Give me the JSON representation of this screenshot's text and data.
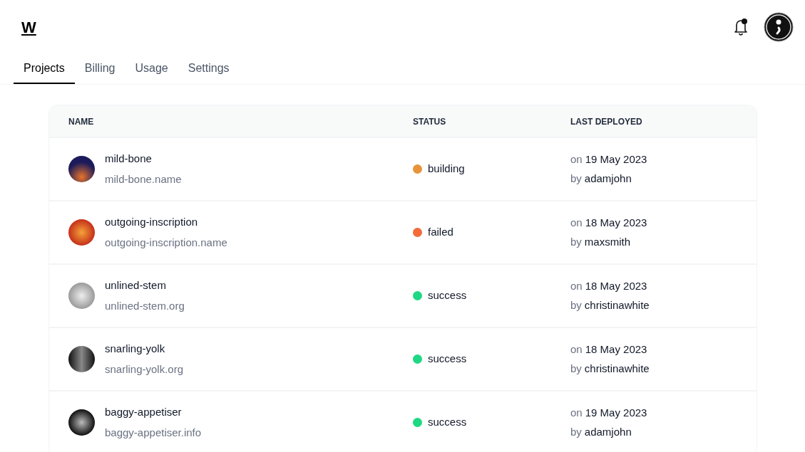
{
  "logo": "W",
  "tabs": [
    {
      "label": "Projects",
      "selected": true
    },
    {
      "label": "Billing",
      "selected": false
    },
    {
      "label": "Usage",
      "selected": false
    },
    {
      "label": "Settings",
      "selected": false
    }
  ],
  "notifications": {
    "unread": true
  },
  "table": {
    "columns": [
      "NAME",
      "STATUS",
      "LAST DEPLOYED"
    ],
    "rows": [
      {
        "name": "mild-bone",
        "domain": "mild-bone.name",
        "status": "building",
        "color": "#e8933a",
        "date_prefix": "on",
        "date": "19 May 2023",
        "user_prefix": "by",
        "user": "adamjohn"
      },
      {
        "name": "outgoing-inscription",
        "domain": "outgoing-inscription.name",
        "status": "failed",
        "color": "#f26b3a",
        "date_prefix": "on",
        "date": "18 May 2023",
        "user_prefix": "by",
        "user": "maxsmith"
      },
      {
        "name": "unlined-stem",
        "domain": "unlined-stem.org",
        "status": "success",
        "color": "#1fd883",
        "date_prefix": "on",
        "date": "18 May 2023",
        "user_prefix": "by",
        "user": "christinawhite"
      },
      {
        "name": "snarling-yolk",
        "domain": "snarling-yolk.org",
        "status": "success",
        "color": "#1fd883",
        "date_prefix": "on",
        "date": "18 May 2023",
        "user_prefix": "by",
        "user": "christinawhite"
      },
      {
        "name": "baggy-appetiser",
        "domain": "baggy-appetiser.info",
        "status": "success",
        "color": "#1fd883",
        "date_prefix": "on",
        "date": "19 May 2023",
        "user_prefix": "by",
        "user": "adamjohn"
      }
    ]
  }
}
